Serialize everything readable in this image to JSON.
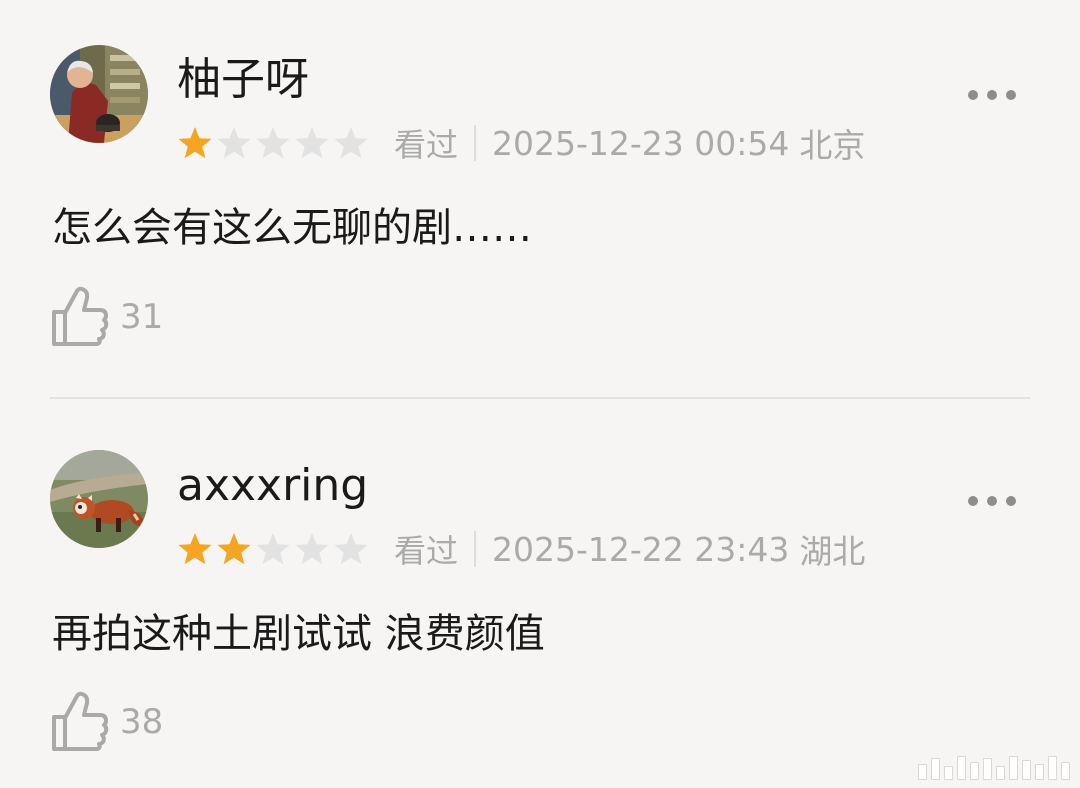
{
  "comments": [
    {
      "username": "柚子呀",
      "rating": 1,
      "rating_max": 5,
      "status": "看过",
      "time": "2025-12-23 00:54",
      "location": "北京",
      "content": "怎么会有这么无聊的剧……",
      "likes": "31",
      "avatar_icon": "avatar-person-photo"
    },
    {
      "username": "axxxring",
      "rating": 2,
      "rating_max": 5,
      "status": "看过",
      "time": "2025-12-22 23:43",
      "location": "湖北",
      "content": "再拍这种土剧试试 浪费颜值",
      "likes": "38",
      "avatar_icon": "avatar-red-panda-photo"
    }
  ],
  "colors": {
    "background": "#f6f5f3",
    "star_filled": "#f4a623",
    "star_empty": "#e2e2e2",
    "meta_text": "#aaaaaa",
    "body_text": "#1a1a1a"
  }
}
